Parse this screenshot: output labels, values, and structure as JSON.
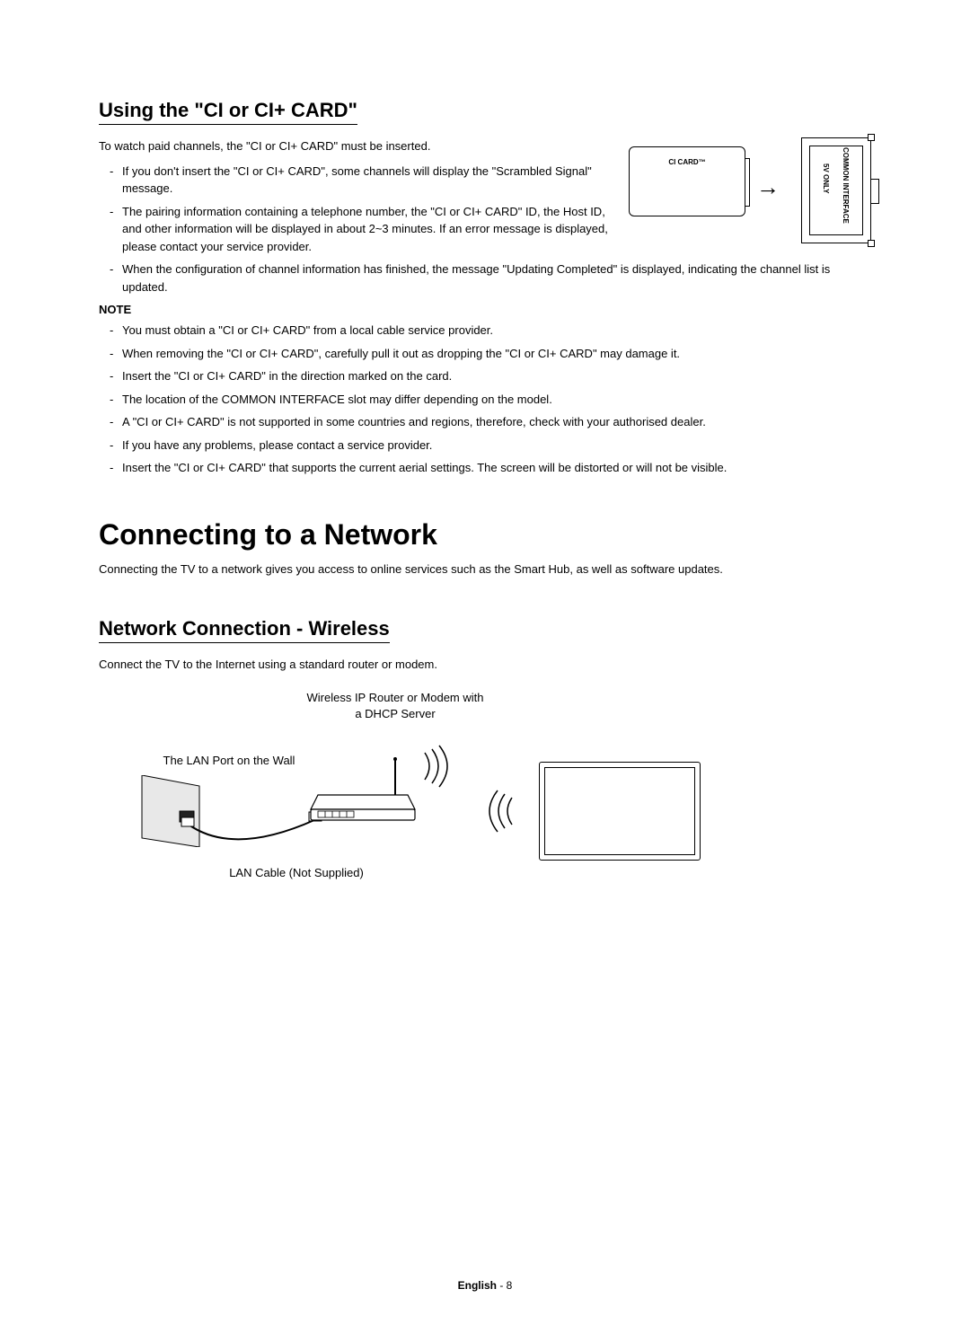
{
  "section1": {
    "heading": "Using the \"CI or CI+ CARD\"",
    "intro": "To watch paid channels, the \"CI or CI+ CARD\" must be inserted.",
    "bullets_top": [
      "If you don't insert the \"CI or CI+ CARD\", some channels will display the \"Scrambled Signal\" message.",
      "The pairing information containing a telephone number, the \"CI or CI+ CARD\" ID, the Host ID, and other information will be displayed in about 2~3 minutes. If an error message is displayed, please contact your service provider."
    ],
    "bullets_bottom": [
      "When the configuration of channel information has finished, the message \"Updating Completed\" is displayed, indicating the channel list is updated."
    ],
    "note_label": "NOTE",
    "notes": [
      "You must obtain a \"CI or CI+ CARD\" from a local cable service provider.",
      "When removing the \"CI or CI+ CARD\", carefully pull it out as dropping the \"CI or CI+ CARD\" may damage it.",
      "Insert the \"CI or CI+ CARD\" in the direction marked on the card.",
      "The location of the COMMON INTERFACE slot may differ depending on the model.",
      "A \"CI or CI+ CARD\" is not supported in some countries and regions, therefore, check with your authorised dealer.",
      "If you have any problems, please contact a service provider.",
      "Insert the \"CI or CI+ CARD\" that supports the current aerial settings. The screen will be distorted or will not be visible."
    ],
    "diagram": {
      "card_label": "CI CARD™",
      "slot_label1": "5V ONLY",
      "slot_label2": "COMMON INTERFACE"
    }
  },
  "chapter": {
    "heading": "Connecting to a Network",
    "intro": "Connecting the TV to a network gives you access to online services such as the Smart Hub, as well as software updates."
  },
  "section2": {
    "heading": "Network Connection - Wireless",
    "intro": "Connect the TV to the Internet using a standard router or modem.",
    "diagram": {
      "router_label": "Wireless IP Router or Modem with a DHCP Server",
      "wall_label": "The LAN Port on the Wall",
      "lan_label": "LAN Cable (Not Supplied)"
    }
  },
  "footer": {
    "lang": "English",
    "sep": " - ",
    "page": "8"
  }
}
